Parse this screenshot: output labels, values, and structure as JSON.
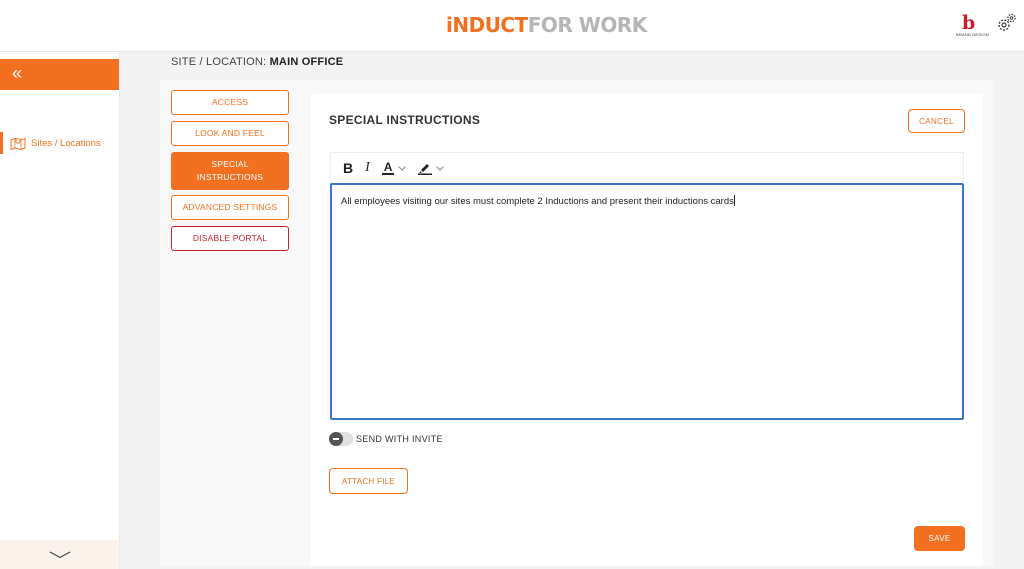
{
  "header": {
    "logo_part1": "iNDUCT",
    "logo_part2": "FOR WORK",
    "brand_letter": "b",
    "brand_text": "BRAND DESIGN",
    "settings_icon": "gear-icon"
  },
  "sidebar": {
    "collapse_label": "«",
    "items": [
      {
        "label": "Sites / Locations",
        "icon": "map-location-icon"
      }
    ]
  },
  "breadcrumb": {
    "prefix": "SITE / LOCATION:",
    "value": "MAIN OFFICE"
  },
  "nav": {
    "access": "ACCESS",
    "look_and_feel": "LOOK AND FEEL",
    "special_line1": "SPECIAL",
    "special_line2": "INSTRUCTIONS",
    "advanced_settings": "ADVANCED SETTINGS",
    "disable_portal": "DISABLE PORTAL"
  },
  "panel": {
    "title": "SPECIAL INSTRUCTIONS",
    "cancel_label": "CANCEL",
    "editor_text": "All employees visiting our sites must complete 2 Inductions and present their inductions cards",
    "toolbar": {
      "bold_label": "B",
      "italic_label": "I",
      "text_color_label": "A"
    },
    "send_with_invite_label": "SEND WITH INVITE",
    "attach_label": "ATTACH FILE",
    "save_label": "SAVE"
  },
  "colors": {
    "accent": "#f37021",
    "danger": "#c8202f",
    "focus": "#3777c8"
  }
}
